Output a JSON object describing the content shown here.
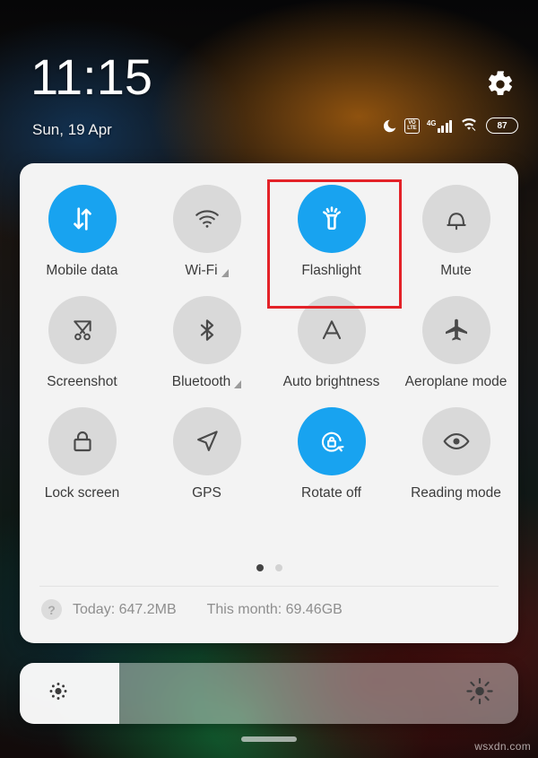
{
  "statusbar": {
    "time": "11:15",
    "date": "Sun, 19 Apr",
    "gear_icon": "gear-icon",
    "icons": {
      "dnd": "moon-icon",
      "volte_top": "VO",
      "volte_bottom": "LTE",
      "network_label": "4G",
      "wifi": "wifi-slash-icon",
      "battery_level": "87"
    }
  },
  "quick_settings": {
    "tiles": [
      {
        "label": "Mobile data",
        "icon": "mobile-data-icon",
        "active": true,
        "expandable": false
      },
      {
        "label": "Wi-Fi",
        "icon": "wifi-icon",
        "active": false,
        "expandable": true
      },
      {
        "label": "Flashlight",
        "icon": "flashlight-icon",
        "active": true,
        "expandable": false,
        "highlighted": true
      },
      {
        "label": "Mute",
        "icon": "bell-icon",
        "active": false,
        "expandable": false
      },
      {
        "label": "Screenshot",
        "icon": "scissors-icon",
        "active": false,
        "expandable": false
      },
      {
        "label": "Bluetooth",
        "icon": "bluetooth-icon",
        "active": false,
        "expandable": true
      },
      {
        "label": "Auto brightness",
        "icon": "auto-brightness-icon",
        "active": false,
        "expandable": false
      },
      {
        "label": "Aeroplane mode",
        "icon": "airplane-icon",
        "active": false,
        "expandable": false
      },
      {
        "label": "Lock screen",
        "icon": "lock-icon",
        "active": false,
        "expandable": false
      },
      {
        "label": "GPS",
        "icon": "navigation-arrow-icon",
        "active": false,
        "expandable": false
      },
      {
        "label": "Rotate off",
        "icon": "rotate-lock-icon",
        "active": true,
        "expandable": false
      },
      {
        "label": "Reading mode",
        "icon": "eye-icon",
        "active": false,
        "expandable": false
      }
    ],
    "pages": {
      "count": 2,
      "active_index": 0
    },
    "data_usage": {
      "help_icon": "question-mark-icon",
      "today": "Today: 647.2MB",
      "this_month": "This month: 69.46GB"
    }
  },
  "brightness": {
    "low_icon": "brightness-low-icon",
    "high_icon": "brightness-high-icon",
    "value_percent": 20
  },
  "home_indicator": "home-indicator",
  "watermark": "wsxdn.com",
  "colors": {
    "accent_on": "#18a3f0",
    "tile_off": "#d9d9d9",
    "panel_bg": "#f3f3f3",
    "highlight": "#e32228",
    "label": "#3b3b3b"
  }
}
